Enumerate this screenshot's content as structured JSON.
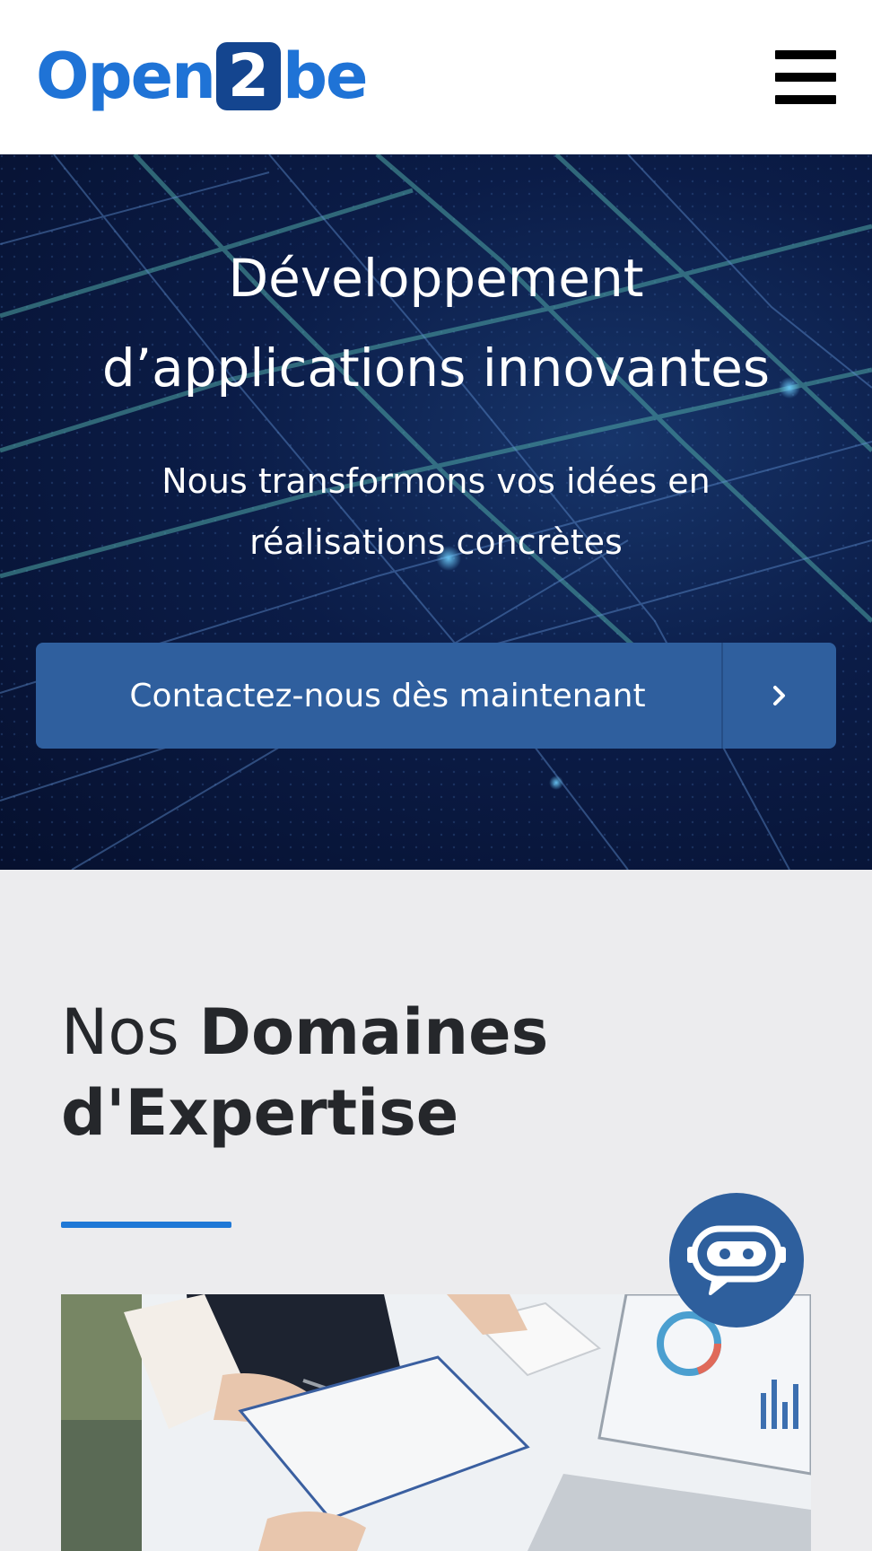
{
  "header": {
    "logo": {
      "part1": "Open",
      "part2": "2",
      "part3": "be"
    },
    "menu_icon": "hamburger-menu-icon"
  },
  "hero": {
    "title_line1": "Développement",
    "title_line2": "d’applications innovantes",
    "subtitle_line1": "Nous transformons vos idées en",
    "subtitle_line2": "réalisations concrètes",
    "cta_label": "Contactez-nous dès maintenant",
    "cta_icon": "chevron-right-icon"
  },
  "expertise": {
    "title_light": "Nos ",
    "title_bold_line1": "Domaines",
    "title_bold_line2": "d'Expertise"
  },
  "chatbot": {
    "icon": "robot-chat-icon"
  },
  "colors": {
    "brand_blue": "#1f73d6",
    "logo_box": "#14458f",
    "cta_blue": "#2f5f9e",
    "accent_line": "#1f78d6",
    "page_bg": "#ececee",
    "heading_text": "#25272b"
  }
}
